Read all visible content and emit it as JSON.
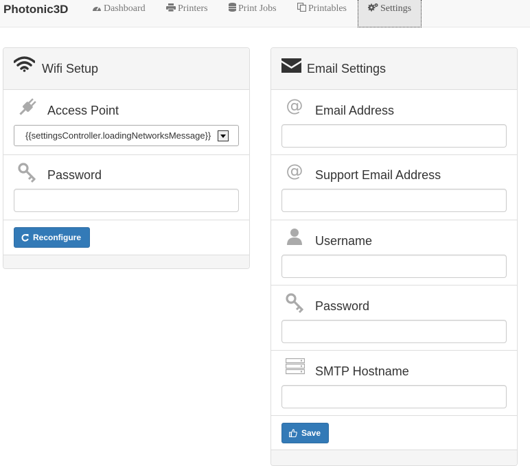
{
  "nav": {
    "brand": "Photonic3D",
    "items": [
      {
        "label": "Dashboard",
        "icon": "dashboard-icon"
      },
      {
        "label": "Printers",
        "icon": "print-icon"
      },
      {
        "label": "Print Jobs",
        "icon": "database-icon"
      },
      {
        "label": "Printables",
        "icon": "copy-icon"
      },
      {
        "label": "Settings",
        "icon": "cogs-icon",
        "active": true
      }
    ]
  },
  "wifi": {
    "title": "Wifi Setup",
    "icon": "wifi-icon",
    "access_point": {
      "label": "Access Point",
      "icon": "plug-icon",
      "selected": "{{settingsController.loadingNetworksMessage}}"
    },
    "password": {
      "label": "Password",
      "icon": "key-icon",
      "value": ""
    },
    "reconfigure_label": "Reconfigure"
  },
  "email": {
    "title": "Email Settings",
    "icon": "envelope-icon",
    "fields": [
      {
        "label": "Email Address",
        "icon": "at-icon",
        "value": ""
      },
      {
        "label": "Support Email Address",
        "icon": "at-icon",
        "value": ""
      },
      {
        "label": "Username",
        "icon": "user-icon",
        "value": ""
      },
      {
        "label": "Password",
        "icon": "key-icon",
        "value": ""
      },
      {
        "label": "SMTP Hostname",
        "icon": "server-icon",
        "value": ""
      }
    ],
    "save_label": "Save"
  },
  "colors": {
    "primary": "#337ab7",
    "navbar_bg": "#f8f8f8",
    "panel_heading_bg": "#f5f5f5",
    "icon_gray": "#aaaaaa"
  }
}
